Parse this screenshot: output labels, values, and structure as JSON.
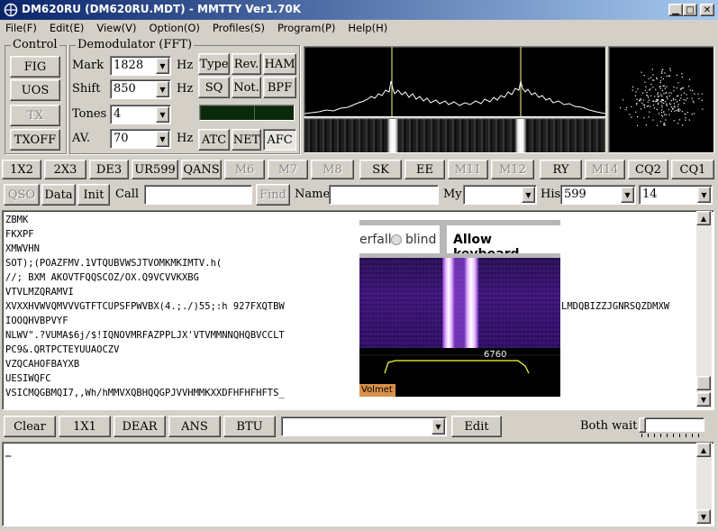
{
  "window": {
    "title": "DM620RU (DM620RU.MDT) - MMTTY Ver1.70K"
  },
  "menu": [
    "File(F)",
    "Edit(E)",
    "View(V)",
    "Option(O)",
    "Profiles(S)",
    "Program(P)",
    "Help(H)"
  ],
  "control": {
    "title": "Control",
    "fig": "FIG",
    "uos": "UOS",
    "tx": "TX",
    "txoff": "TXOFF"
  },
  "demod": {
    "title": "Demodulator (FFT)",
    "mark_label": "Mark",
    "mark_value": "1828",
    "shift_label": "Shift",
    "shift_value": "850",
    "tones_label": "Tones",
    "tones_value": "4",
    "av_label": "AV.",
    "av_value": "70",
    "hz": "Hz",
    "type": "Type",
    "rev": "Rev.",
    "ham": "HAM",
    "sq": "SQ",
    "not": "Not.",
    "bpf": "BPF",
    "atc": "ATC",
    "net": "NET",
    "afc": "AFC"
  },
  "macros": [
    "1X2",
    "2X3",
    "DE3",
    "UR599",
    "QANS",
    "M6",
    "M7",
    "M8",
    "SK",
    "EE",
    "M11",
    "M12",
    "RY",
    "M14",
    "CQ2",
    "CQ1"
  ],
  "logbar": {
    "qso": "QSO",
    "data": "Data",
    "init": "Init",
    "call_label": "Call",
    "call_value": "",
    "find": "Find",
    "name_label": "Name",
    "name_value": "",
    "my_label": "My",
    "my_value": "",
    "his_label": "His",
    "his_value": "599",
    "extra_value": "14"
  },
  "rx_lines": [
    "ZBMK",
    "FKXPF",
    "XMWVHN",
    "SOT);(POAZFMV.1VTQUBVWSJTVOMKMKIMTV.h(",
    "//; BXM AKOVTFQQSCOZ/OX.Q9VCVVKXBG",
    "VTVLMZQRAMVI",
    "XVXXHVWVQMVVVGTFTCUPSFPWVBX(4.;./)55;:h 927FXQTBW",
    "IOOQHVBPVYF",
    "NLWV\".?VUMA$6j/$!IQNOVMRFAZPPLJX'VTVMMNNQHQBVCCLT",
    "PC9&.QRTPCTEYUUAOCZV",
    "VZQCAHOFBAYXB",
    "UESIWQFC",
    "VSICMQGBMQI7,,Wh/hMMVXQBHQQGPJVVHMMKXXDFHFHFHFTS_"
  ],
  "rx_tail": "LMDQBIZZJGNRSQZDMXW",
  "overlay": {
    "waterfall_text": "erfall",
    "blind_label": "blind",
    "keyboard_label": "Allow keyboard",
    "freq_label": "6760",
    "volmet_tag": "Volmet"
  },
  "txbar": {
    "clear": "Clear",
    "b1": "1X1",
    "b2": "DEAR",
    "b3": "ANS",
    "b4": "BTU",
    "combo_value": "",
    "edit": "Edit",
    "both_wait": "Both wait"
  },
  "tx_text": "_",
  "colors": {
    "title_from": "#0a246a",
    "title_to": "#a6caf0",
    "scope_bg": "#000000",
    "wave": "#ffffff",
    "marker": "#ffff80",
    "waterfall_purple": "#5a1a8a",
    "volmet_tag": "#d9904a"
  }
}
